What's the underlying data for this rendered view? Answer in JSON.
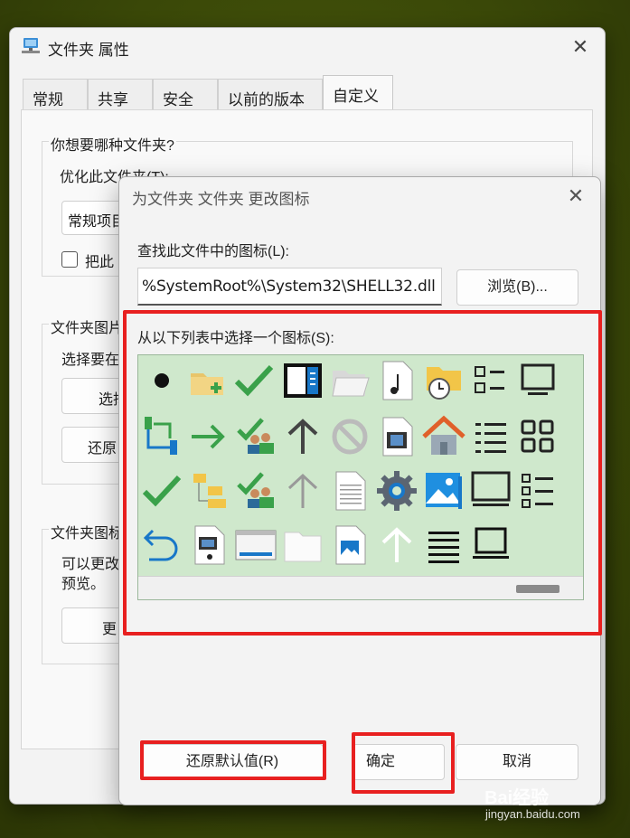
{
  "window": {
    "title": "文件夹 属性",
    "close": "✕"
  },
  "tabs": [
    "常规",
    "共享",
    "安全",
    "以前的版本",
    "自定义"
  ],
  "panel": {
    "group1_title": "你想要哪种文件夹?",
    "optimize_label": "优化此文件夹(T):",
    "optimize_value": "常规项目",
    "apply_sub_text": "把此",
    "group2_title": "文件夹图片",
    "choose_text": "选择要在",
    "choose_btn": "选择",
    "restore_btn": "还原",
    "group3_title": "文件夹图标",
    "change_text": "可以更改",
    "preview_text": "预览。",
    "change_btn": "更"
  },
  "dialog": {
    "title": "为文件夹 文件夹 更改图标",
    "close": "✕",
    "find_label": "查找此文件中的图标(L):",
    "path_value": "%SystemRoot%\\System32\\SHELL32.dll",
    "browse_label": "浏览(B)...",
    "list_label": "从以下列表中选择一个图标(S):",
    "restore_label": "还原默认值(R)",
    "ok_label": "确定",
    "cancel_label": "取消"
  },
  "icons": [
    "black-dot-icon",
    "folder-add-icon",
    "green-check-icon",
    "sidebar-panel-icon",
    "open-folder-icon",
    "music-file-icon",
    "folder-clock-icon",
    "list-dash-icon",
    "monitor-icon",
    "network-branch-icon",
    "green-arrow-icon",
    "users-check-icon",
    "up-arrow-icon",
    "no-entry-icon",
    "video-file-icon",
    "home-icon",
    "list-lines-icon",
    "grid-squares-icon",
    "green-check-2-icon",
    "folder-tree-icon",
    "users-check-2-icon",
    "up-arrow-gray-icon",
    "text-document-icon",
    "settings-gear-icon",
    "photo-gallery-icon",
    "screen-icon",
    "checklist-icon",
    "undo-arrow-icon",
    "media-file-icon",
    "window-pane-icon",
    "blank-folder-icon",
    "image-file-icon",
    "up-arrow-light-icon",
    "lines-icon",
    "laptop-screen-icon"
  ],
  "watermark": {
    "brand": "Bai经验",
    "url": "jingyan.baidu.com"
  },
  "colors": {
    "highlight": "#e82020",
    "icon_list_bg": "#cfe8cc",
    "accent_green": "#3aa14a",
    "accent_blue": "#1877c8"
  }
}
